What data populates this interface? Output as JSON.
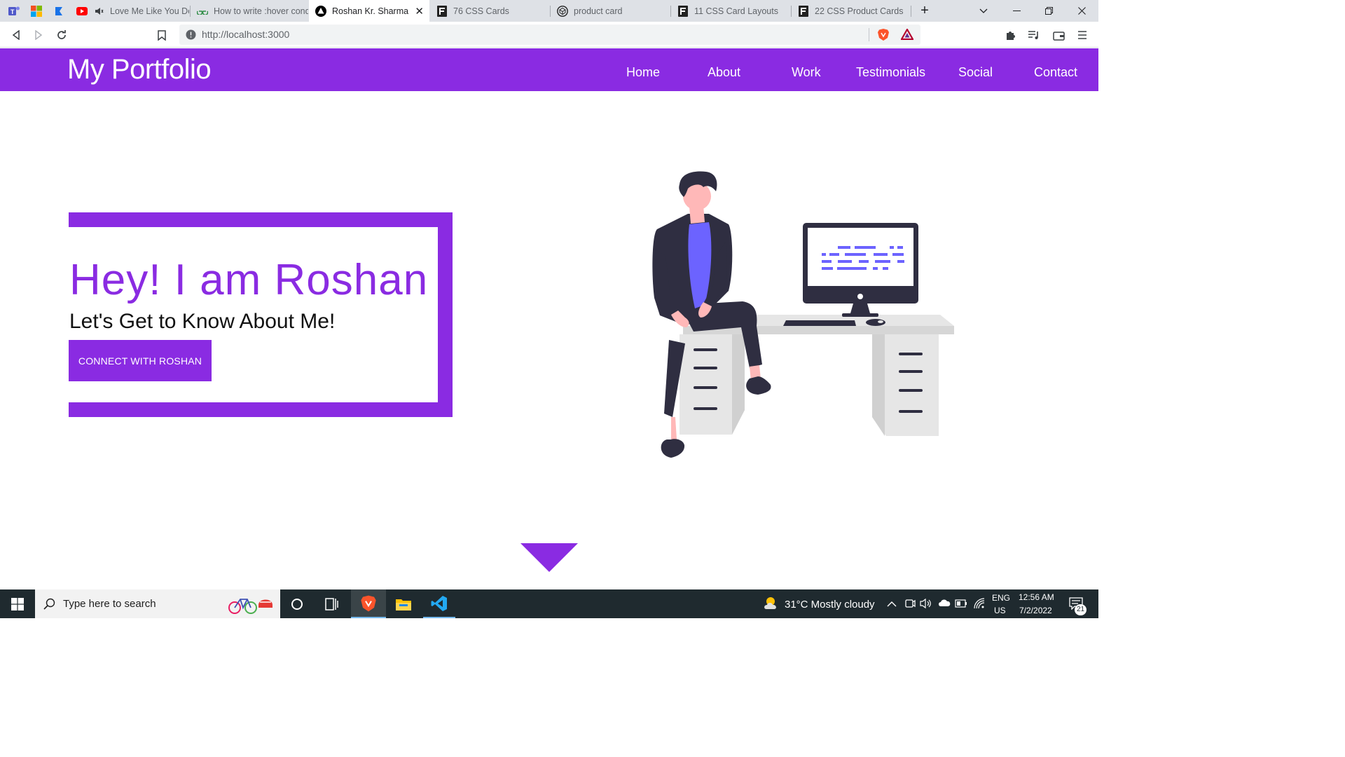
{
  "browser": {
    "tabs": [
      {
        "title": "Love Me Like You Do",
        "icon": "youtube-icon",
        "muted": true
      },
      {
        "title": "How to write :hover condition",
        "icon": "geeksforgeeks-icon"
      },
      {
        "title": "Roshan Kr. Sharma",
        "icon": "react-app-icon",
        "active": true
      },
      {
        "title": "76 CSS Cards",
        "icon": "freefrontend-icon"
      },
      {
        "title": "product card",
        "icon": "codepen-icon"
      },
      {
        "title": "11 CSS Card Layouts",
        "icon": "freefrontend-icon"
      },
      {
        "title": "22 CSS Product Cards",
        "icon": "freefrontend-icon"
      }
    ],
    "url": "http://localhost:3000"
  },
  "nav": {
    "brand": "My Portfolio",
    "links": [
      "Home",
      "About",
      "Work",
      "Testimonials",
      "Social",
      "Contact"
    ]
  },
  "hero": {
    "title": "Hey! I am Roshan",
    "subtitle": "Let's Get to Know About Me!",
    "cta": "CONNECT WITH ROSHAN"
  },
  "taskbar": {
    "search_placeholder": "Type here to search",
    "weather": "31°C  Mostly cloudy",
    "lang": "ENG",
    "region": "US",
    "time": "12:56 AM",
    "date": "7/2/2022",
    "notifications": "21"
  },
  "colors": {
    "accent": "#8a2be2",
    "illustration_screen": "#6c63ff",
    "dark": "#2f2e41"
  }
}
